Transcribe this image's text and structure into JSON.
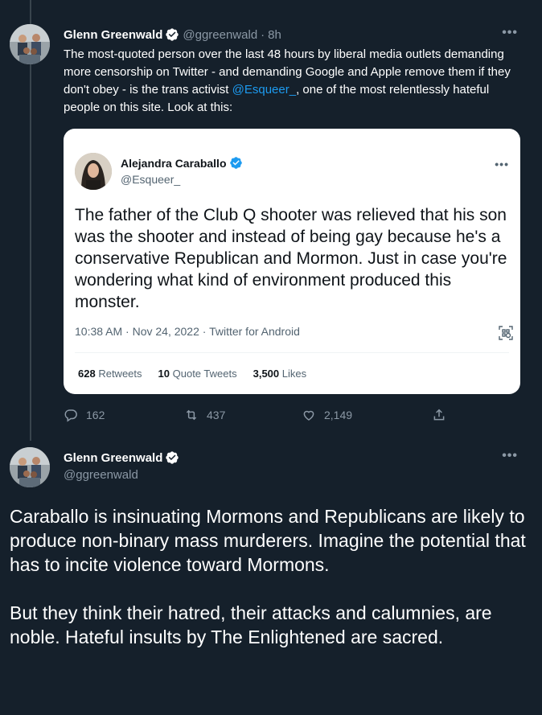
{
  "tweet1": {
    "author_name": "Glenn Greenwald",
    "author_handle": "@ggreenwald",
    "time": "8h",
    "more": "•••",
    "text_before_mention": "The most-quoted person over the last 48 hours by liberal media outlets demanding more censorship on Twitter - and demanding Google and Apple remove them if they don't obey - is the trans activist ",
    "mention": "@Esqueer_",
    "text_after_mention": ", one of the most relentlessly hateful people on this site. Look at this:",
    "actions": {
      "replies": "162",
      "retweets": "437",
      "likes": "2,149"
    }
  },
  "quoted": {
    "author_name": "Alejandra Caraballo",
    "author_handle": "@Esqueer_",
    "more": "•••",
    "text": "The father of the Club Q shooter was relieved that his son was the shooter and instead of being gay because he's a conservative Republican and Mormon. Just in case you're wondering what kind of environment produced this monster.",
    "meta": "10:38 AM · Nov 24, 2022 · Twitter for Android",
    "stats": {
      "retweets_count": "628",
      "retweets_label": "Retweets",
      "quotes_count": "10",
      "quotes_label": "Quote Tweets",
      "likes_count": "3,500",
      "likes_label": "Likes"
    }
  },
  "tweet2": {
    "author_name": "Glenn Greenwald",
    "author_handle": "@ggreenwald",
    "more": "•••",
    "paragraph1": "Caraballo is insinuating Mormons and Republicans are likely to produce non-binary mass murderers. Imagine the potential that has to incite violence toward Mormons.",
    "paragraph2": "But they think their hatred, their attacks and calumnies, are noble. Hateful insults by The Enlightened are sacred."
  },
  "colors": {
    "background": "#15202b",
    "accent": "#1d9bf0",
    "muted": "#8b98a5",
    "card": "#ffffff"
  }
}
